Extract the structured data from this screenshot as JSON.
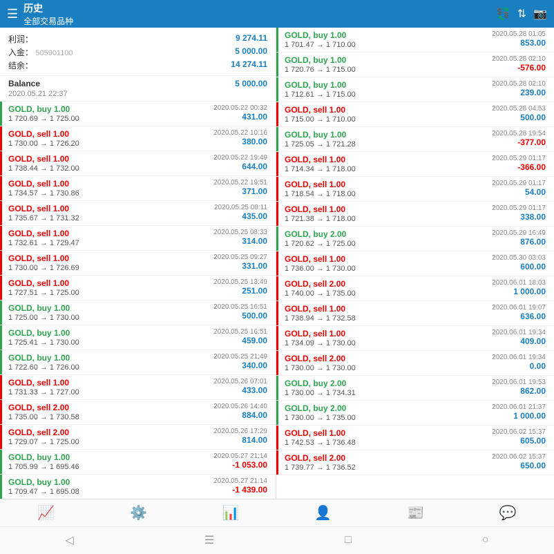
{
  "header": {
    "menu_icon": "☰",
    "title": "历史",
    "subtitle": "全部交易品种",
    "icon1": "💱",
    "icon2": "↕",
    "icon3": "📷"
  },
  "summary": {
    "profit_label": "利润：",
    "profit_value": "9 274.11",
    "deposit_label": "入金：",
    "deposit_value": "5 000.00",
    "balance_label": "结余：",
    "balance_value": "14 274.11",
    "watermark": "505901100"
  },
  "balance": {
    "label": "Balance",
    "date": "2020.05.21 22:37",
    "value": "5 000.00"
  },
  "left_trades": [
    {
      "type": "buy",
      "label": "GOLD, buy 1.00",
      "price": "1 720.69 → 1 725.00",
      "date": "2020.05.22 00:32",
      "profit": "431.00",
      "profit_type": "pos"
    },
    {
      "type": "sell",
      "label": "GOLD, sell 1.00",
      "price": "1 730.00 → 1 726.20",
      "date": "2020.05.22 10:16",
      "profit": "380.00",
      "profit_type": "pos"
    },
    {
      "type": "sell",
      "label": "GOLD, sell 1.00",
      "price": "1 738.44 → 1 732.00",
      "date": "2020.05.22 19:49",
      "profit": "644.00",
      "profit_type": "pos"
    },
    {
      "type": "sell",
      "label": "GOLD, sell 1.00",
      "price": "1 734.57 → 1 730.86",
      "date": "2020.05.22 19:51",
      "profit": "371.00",
      "profit_type": "pos"
    },
    {
      "type": "sell",
      "label": "GOLD, sell 1.00",
      "price": "1 735.67 → 1 731.32",
      "date": "2020.05.25 08:11",
      "profit": "435.00",
      "profit_type": "pos"
    },
    {
      "type": "sell",
      "label": "GOLD, sell 1.00",
      "price": "1 732.61 → 1 729.47",
      "date": "2020.05.25 08:33",
      "profit": "314.00",
      "profit_type": "pos"
    },
    {
      "type": "sell",
      "label": "GOLD, sell 1.00",
      "price": "1 730.00 → 1 726.69",
      "date": "2020.05.25 09:27",
      "profit": "331.00",
      "profit_type": "pos"
    },
    {
      "type": "sell",
      "label": "GOLD, sell 1.00",
      "price": "1 727.51 → 1 725.00",
      "date": "2020.05.25 13:49",
      "profit": "251.00",
      "profit_type": "pos"
    },
    {
      "type": "buy",
      "label": "GOLD, buy 1.00",
      "price": "1 725.00 → 1 730.00",
      "date": "2020.05.25 16:51",
      "profit": "500.00",
      "profit_type": "pos"
    },
    {
      "type": "buy",
      "label": "GOLD, buy 1.00",
      "price": "1 725.41 → 1 730.00",
      "date": "2020.05.25 16:51",
      "profit": "459.00",
      "profit_type": "pos"
    },
    {
      "type": "buy",
      "label": "GOLD, buy 1.00",
      "price": "1 722.60 → 1 726.00",
      "date": "2020.05.25 21:49",
      "profit": "340.00",
      "profit_type": "pos"
    },
    {
      "type": "sell",
      "label": "GOLD, sell 1.00",
      "price": "1 731.33 → 1 727.00",
      "date": "2020.05.26 07:01",
      "profit": "433.00",
      "profit_type": "pos"
    },
    {
      "type": "sell",
      "label": "GOLD, sell 2.00",
      "price": "1 735.00 → 1 730.58",
      "date": "2020.05.26 14:40",
      "profit": "884.00",
      "profit_type": "pos"
    },
    {
      "type": "sell",
      "label": "GOLD, sell 2.00",
      "price": "1 729.07 → 1 725.00",
      "date": "2020.05.26 17:29",
      "profit": "814.00",
      "profit_type": "pos"
    },
    {
      "type": "buy",
      "label": "GOLD, buy 1.00",
      "price": "1 705.99 → 1 695.46",
      "date": "2020.05.27 21:14",
      "profit": "-1 053.00",
      "profit_type": "neg"
    },
    {
      "type": "buy",
      "label": "GOLD, buy 1.00",
      "price": "1 709.47 → 1 695.08",
      "date": "2020.05.27 21:14",
      "profit": "-1 439.00",
      "profit_type": "neg"
    },
    {
      "type": "buy",
      "label": "GOLD, buy 1.00",
      "price": "1 701.47 → 1 710.00",
      "date": "2020.05.28 01:05",
      "profit": "853.00",
      "profit_type": "pos"
    },
    {
      "type": "buy",
      "label": "GOLD, buy 1.00",
      "price": "1 720.76 → 1 715.00",
      "date": "2020.05.28 02:10",
      "profit": "-576.00",
      "profit_type": "neg"
    }
  ],
  "right_trades": [
    {
      "type": "buy",
      "label": "GOLD, buy 1.00",
      "price": "1 701.47 → 1 710.00",
      "date": "2020.05.28 01:05",
      "profit": "853.00",
      "profit_type": "pos"
    },
    {
      "type": "buy",
      "label": "GOLD, buy 1.00",
      "price": "1 720.76 → 1 715.00",
      "date": "2020.05.28 02:10",
      "profit": "-576.00",
      "profit_type": "neg"
    },
    {
      "type": "buy",
      "label": "GOLD, buy 1.00",
      "price": "1 712.61 → 1 715.00",
      "date": "2020.05.28 02:10",
      "profit": "239.00",
      "profit_type": "pos"
    },
    {
      "type": "sell",
      "label": "GOLD, sell 1.00",
      "price": "1 715.00 → 1 710.00",
      "date": "2020.05.28 04:53",
      "profit": "500.00",
      "profit_type": "pos"
    },
    {
      "type": "buy",
      "label": "GOLD, buy 1.00",
      "price": "1 725.05 → 1 721.28",
      "date": "2020.05.28 19:54",
      "profit": "-377.00",
      "profit_type": "neg"
    },
    {
      "type": "sell",
      "label": "GOLD, sell 1.00",
      "price": "1 714.34 → 1 718.00",
      "date": "2020.05.29 01:17",
      "profit": "-366.00",
      "profit_type": "neg"
    },
    {
      "type": "sell",
      "label": "GOLD, sell 1.00",
      "price": "1 718.54 → 1 718.00",
      "date": "2020.05.29 01:17",
      "profit": "54.00",
      "profit_type": "pos"
    },
    {
      "type": "sell",
      "label": "GOLD, sell 1.00",
      "price": "1 721.38 → 1 718.00",
      "date": "2020.05.29 01:17",
      "profit": "338.00",
      "profit_type": "pos"
    },
    {
      "type": "buy",
      "label": "GOLD, buy 2.00",
      "price": "1 720.62 → 1 725.00",
      "date": "2020.05.29 16:49",
      "profit": "876.00",
      "profit_type": "pos"
    },
    {
      "type": "sell",
      "label": "GOLD, sell 1.00",
      "price": "1 736.00 → 1 730.00",
      "date": "2020.05.30 03:03",
      "profit": "600.00",
      "profit_type": "pos"
    },
    {
      "type": "sell",
      "label": "GOLD, sell 2.00",
      "price": "1 740.00 → 1 735.00",
      "date": "2020.06.01 18:03",
      "profit": "1 000.00",
      "profit_type": "pos"
    },
    {
      "type": "sell",
      "label": "GOLD, sell 1.00",
      "price": "1 738.94 → 1 732.58",
      "date": "2020.06.01 19:07",
      "profit": "636.00",
      "profit_type": "pos"
    },
    {
      "type": "sell",
      "label": "GOLD, sell 1.00",
      "price": "1 734.09 → 1 730.00",
      "date": "2020.06.01 19:34",
      "profit": "409.00",
      "profit_type": "pos"
    },
    {
      "type": "sell",
      "label": "GOLD, sell 2.00",
      "price": "1 730.00 → 1 730.00",
      "date": "2020.06.01 19:34",
      "profit": "0.00",
      "profit_type": "pos"
    },
    {
      "type": "buy",
      "label": "GOLD, buy 2.00",
      "price": "1 730.00 → 1 734.31",
      "date": "2020.06.01 19:53",
      "profit": "862.00",
      "profit_type": "pos"
    },
    {
      "type": "buy",
      "label": "GOLD, buy 2.00",
      "price": "1 730.00 → 1 735.00",
      "date": "2020.06.01 21:37",
      "profit": "1 000.00",
      "profit_type": "pos"
    },
    {
      "type": "sell",
      "label": "GOLD, sell 1.00",
      "price": "1 742.53 → 1 736.48",
      "date": "2020.06.02 15:37",
      "profit": "605.00",
      "profit_type": "pos"
    },
    {
      "type": "sell",
      "label": "GOLD, sell 2.00",
      "price": "1 739.77 → 1 736.52",
      "date": "2020.06.02 15:37",
      "profit": "650.00",
      "profit_type": "pos"
    }
  ],
  "bottom_icons": [
    {
      "name": "chart-icon",
      "symbol": "📈"
    },
    {
      "name": "settings-icon",
      "symbol": "⚙️"
    },
    {
      "name": "trend-icon",
      "symbol": "📊"
    },
    {
      "name": "account-icon",
      "symbol": "👤"
    },
    {
      "name": "news-icon",
      "symbol": "📰"
    },
    {
      "name": "chat-icon",
      "symbol": "💬"
    }
  ],
  "bottom_nav": [
    {
      "name": "back-icon",
      "symbol": "◁"
    },
    {
      "name": "home-icon",
      "symbol": "☰"
    },
    {
      "name": "square-icon",
      "symbol": "□"
    },
    {
      "name": "circle-icon",
      "symbol": "○"
    }
  ]
}
